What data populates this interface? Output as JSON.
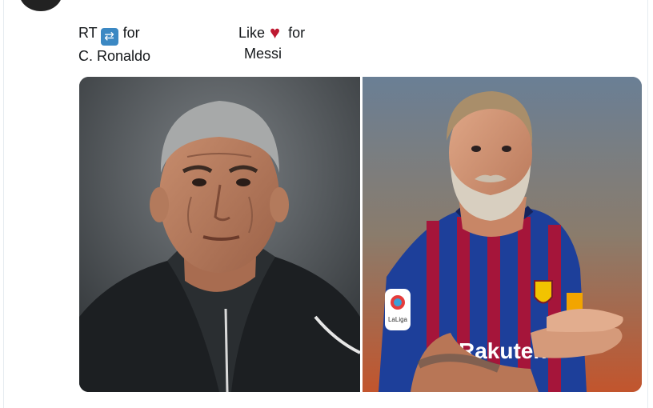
{
  "tweet": {
    "rt_block": {
      "line1_prefix": "RT",
      "rt_emoji": "🔁",
      "line1_suffix": "for",
      "line2": "C. Ronaldo"
    },
    "like_block": {
      "line1_prefix": "Like",
      "heart_emoji": "♥",
      "line1_suffix": "for",
      "line2": "Messi"
    }
  },
  "media": {
    "left_photo": {
      "icon": "ronaldo-aged-photo"
    },
    "right_photo": {
      "icon": "messi-aged-photo",
      "jersey_sponsor": "Rakuten",
      "sleeve_badge": "LaLiga"
    }
  },
  "colors": {
    "rt_blue": "#3b88c3",
    "heart_red": "#be1931",
    "barca_blue": "#1d3f9a",
    "barca_red": "#a5153a"
  }
}
